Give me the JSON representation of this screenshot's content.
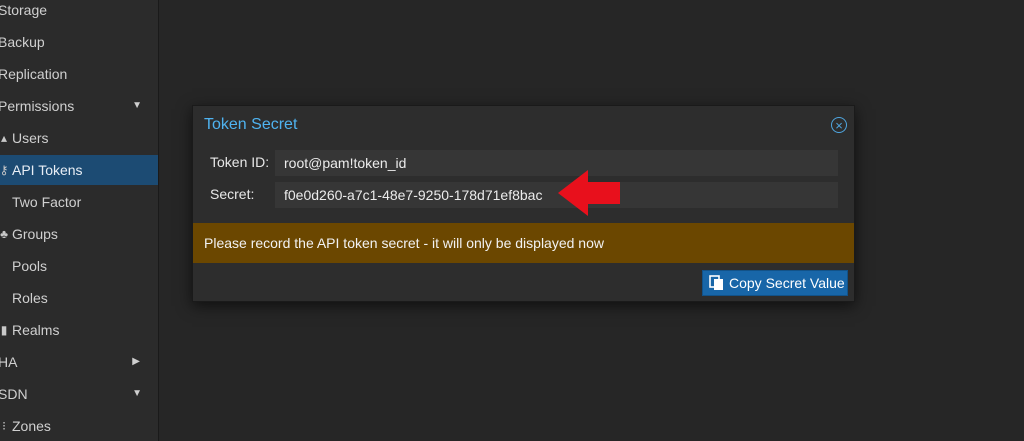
{
  "sidebar": {
    "items": [
      {
        "label": "Storage",
        "icon": "",
        "arrow": ""
      },
      {
        "label": "Backup",
        "icon": "",
        "arrow": ""
      },
      {
        "label": "Replication",
        "icon": "",
        "arrow": ""
      },
      {
        "label": "Permissions",
        "icon": "",
        "arrow": "expanded"
      },
      {
        "label": "Users",
        "icon": "user-icon",
        "arrow": ""
      },
      {
        "label": "API Tokens",
        "icon": "key-icon",
        "arrow": ""
      },
      {
        "label": "Two Factor",
        "icon": "",
        "arrow": ""
      },
      {
        "label": "Groups",
        "icon": "users-icon",
        "arrow": ""
      },
      {
        "label": "Pools",
        "icon": "",
        "arrow": ""
      },
      {
        "label": "Roles",
        "icon": "",
        "arrow": ""
      },
      {
        "label": "Realms",
        "icon": "building-icon",
        "arrow": ""
      },
      {
        "label": "HA",
        "icon": "",
        "arrow": "collapsed"
      },
      {
        "label": "SDN",
        "icon": "",
        "arrow": "expanded"
      },
      {
        "label": "Zones",
        "icon": "grid-icon",
        "arrow": ""
      }
    ],
    "selected": "API Tokens"
  },
  "dialog": {
    "title": "Token Secret",
    "token_id_label": "Token ID:",
    "token_id_value": "root@pam!token_id",
    "secret_label": "Secret:",
    "secret_value": "f0e0d260-a7c1-48e7-9250-178d71ef8bac",
    "warning": "Please record the API token secret - it will only be displayed now",
    "copy_button": "Copy Secret Value"
  },
  "colors": {
    "accent": "#4fb3f0",
    "warning_bg": "#6b4700",
    "button_bg": "#1866a8",
    "annotation_arrow": "#e8101c"
  }
}
